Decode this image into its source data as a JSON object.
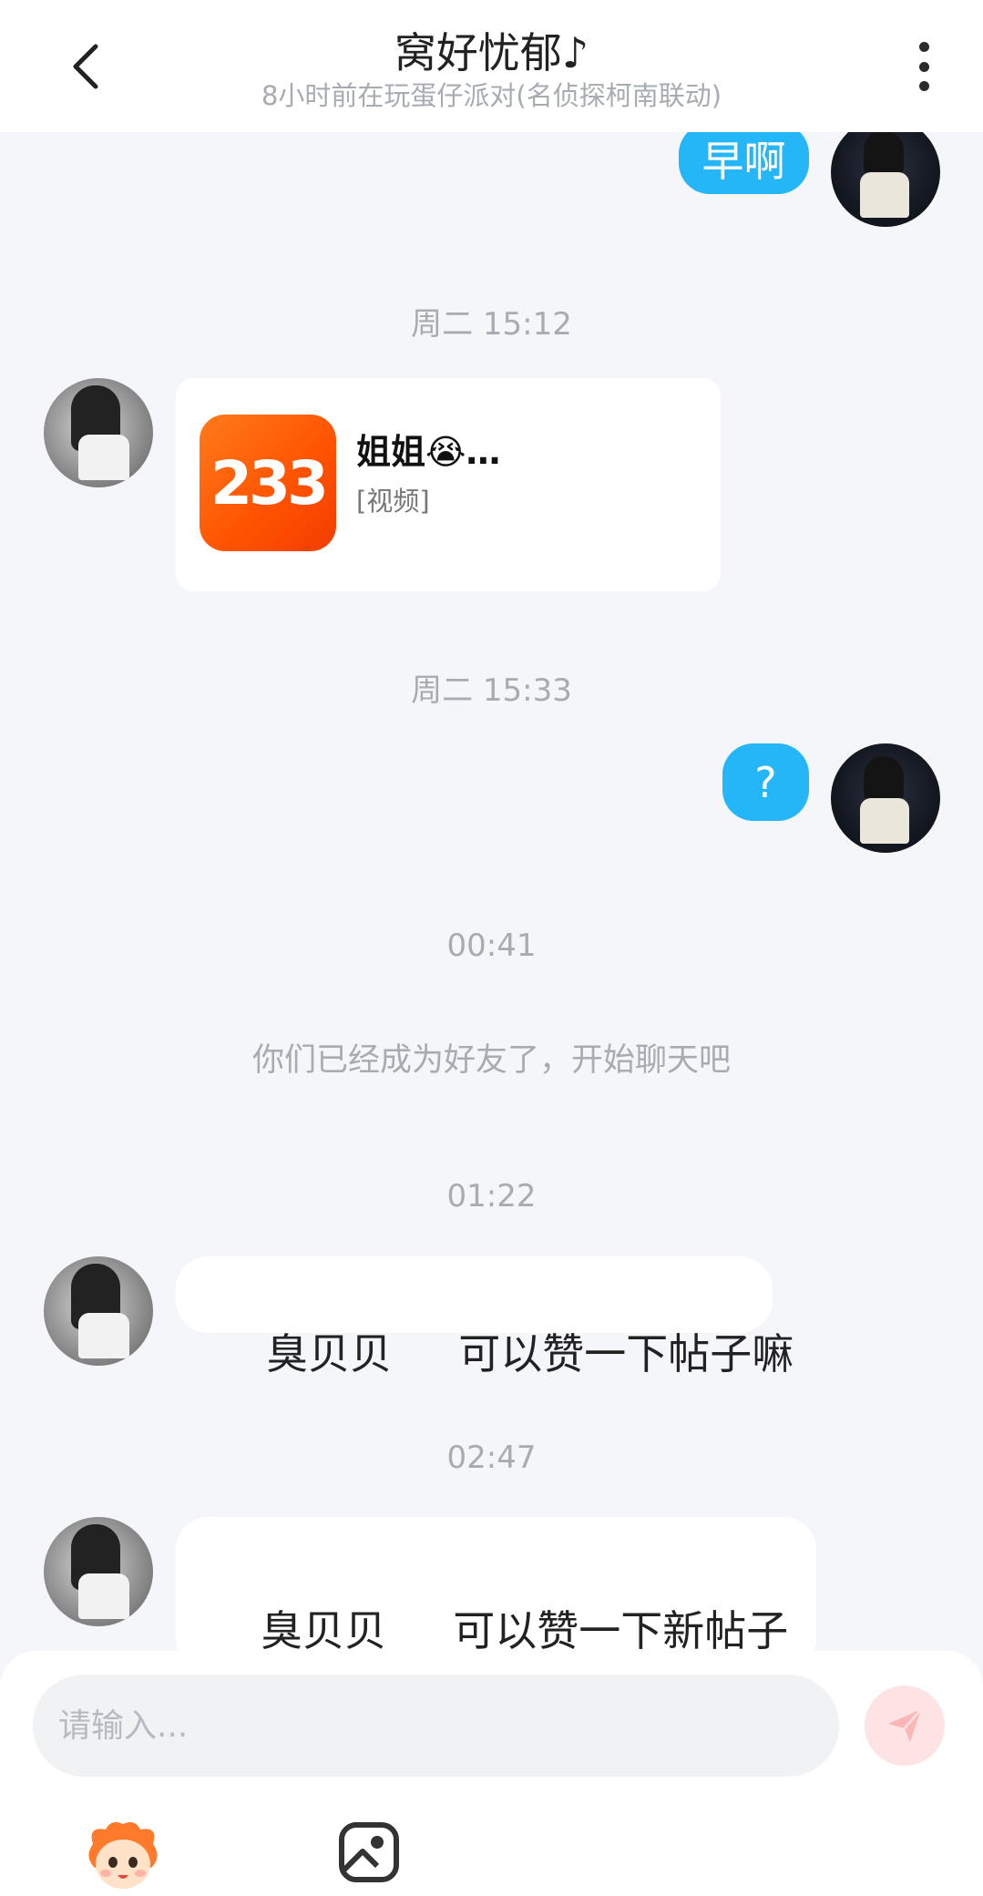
{
  "header": {
    "title": "窝好忧郁♪",
    "subtitle": "8小时前在玩蛋仔派对(名侦探柯南联动)"
  },
  "messages": {
    "m1": {
      "text": "早啊"
    },
    "t1": "周二 15:12",
    "card": {
      "logo_text": "233",
      "title": "姐姐😭…",
      "subtitle": "[视频]"
    },
    "t2": "周二 15:33",
    "m2": {
      "text": "?"
    },
    "t3": "00:41",
    "notice": "你们已经成为好友了，开始聊天吧",
    "t4": "01:22",
    "m3": {
      "text": " 臭贝贝     可以赞一下帖子嘛"
    },
    "t5": "02:47",
    "m4": {
      "text": " 臭贝贝     可以赞一下新帖子嘛 +评论"
    }
  },
  "input": {
    "placeholder": "请输入..."
  },
  "colors": {
    "accent": "#24b6f6",
    "send_disabled": "#fde3e3",
    "background": "#f4f6f9"
  },
  "icons": {
    "back": "chevron-left-icon",
    "more": "more-vertical-icon",
    "send": "paper-plane-icon",
    "emoji": "mascot-emoji-icon",
    "image": "image-icon"
  }
}
